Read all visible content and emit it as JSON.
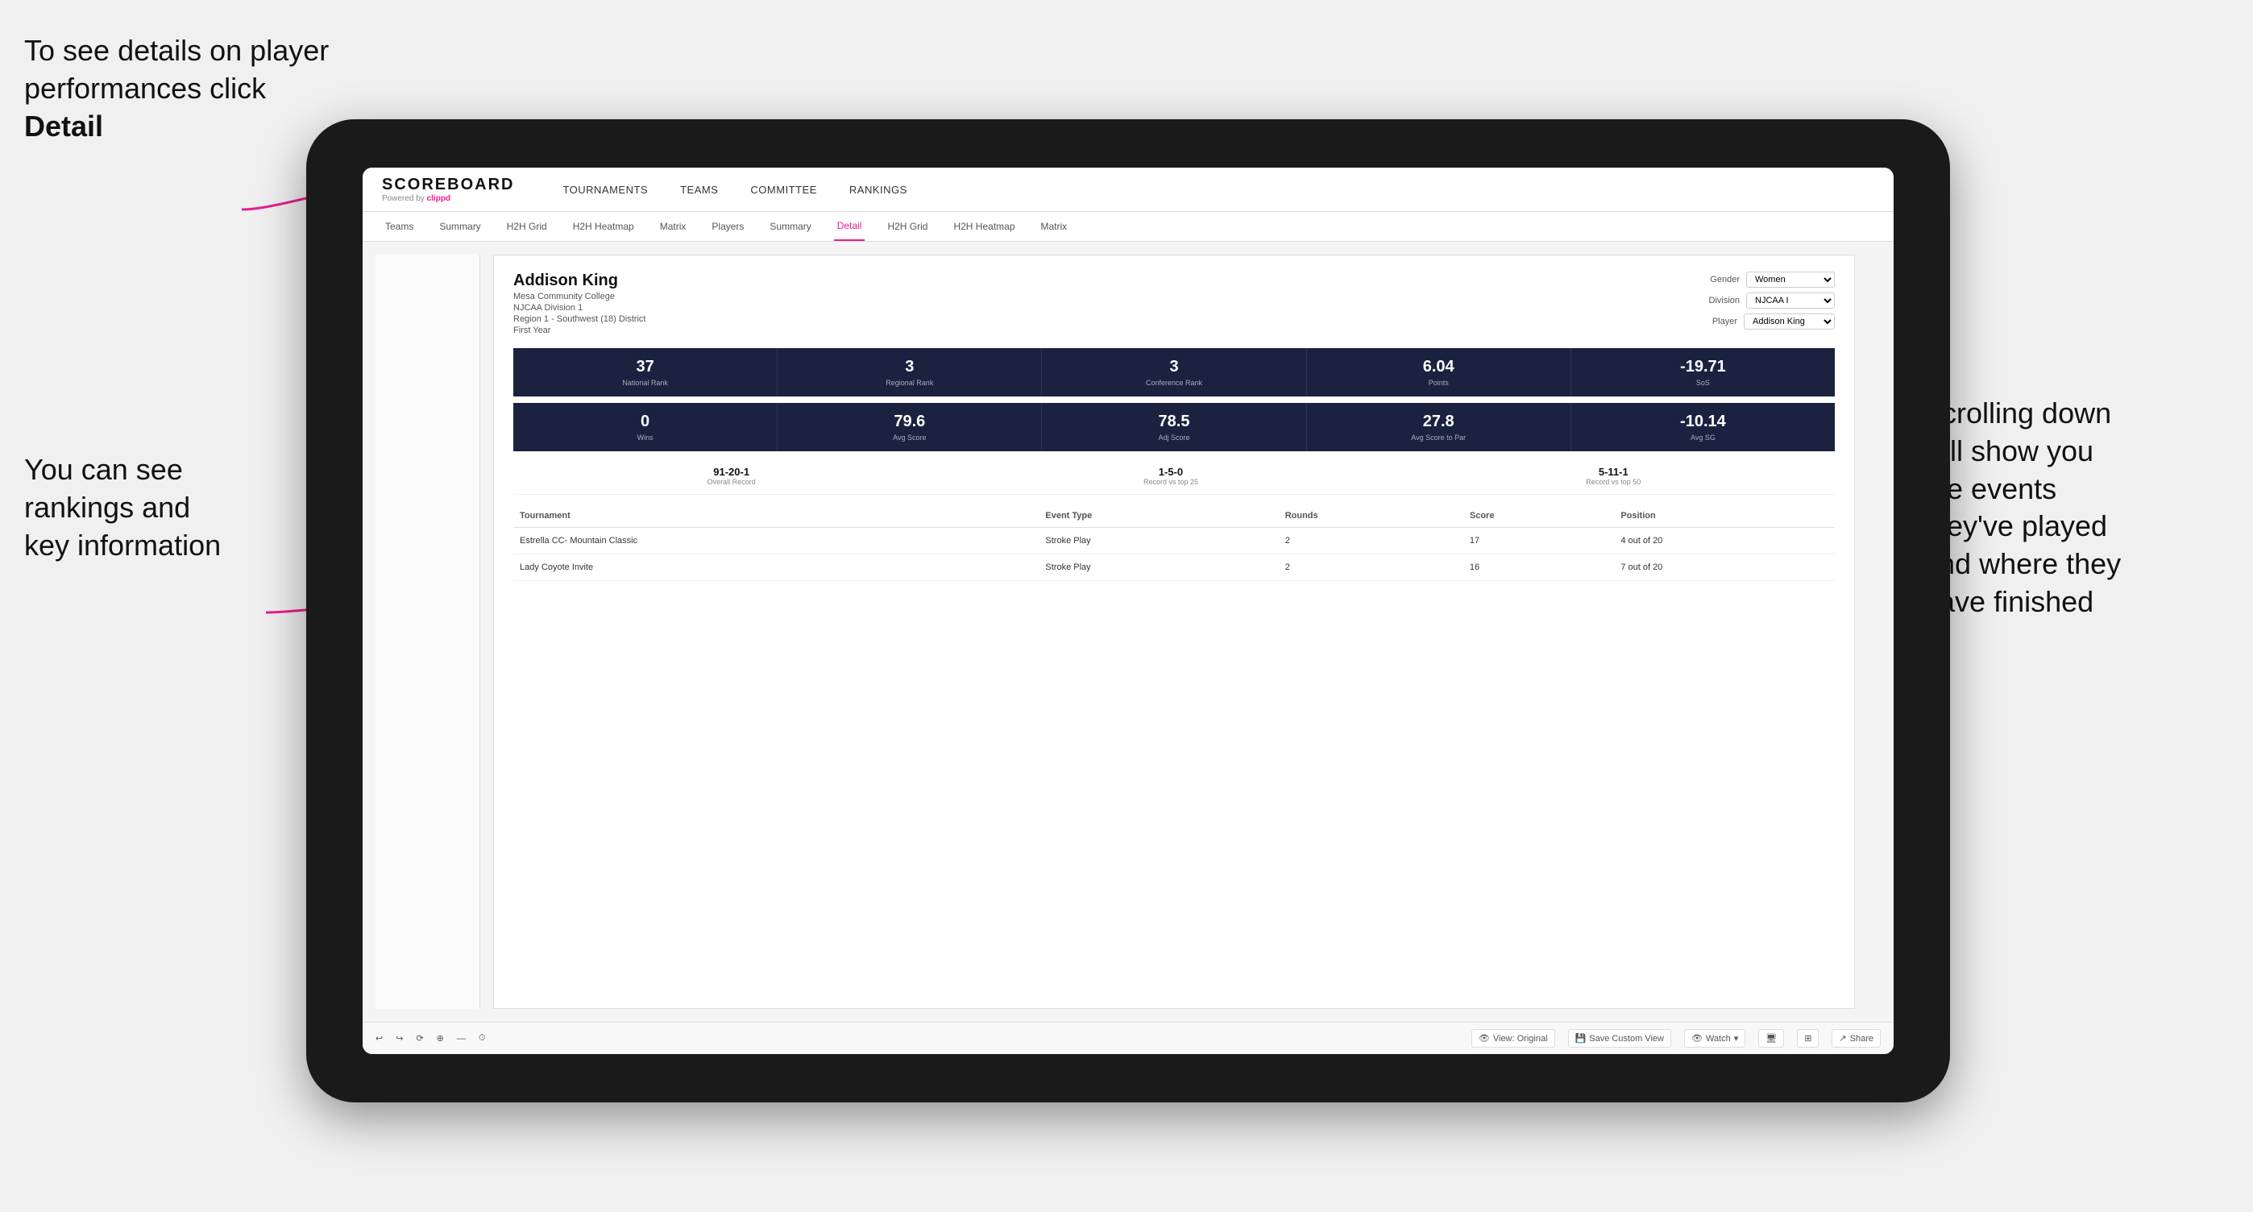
{
  "annotations": {
    "top_left": "To see details on player performances click ",
    "top_left_bold": "Detail",
    "bottom_left_line1": "You can see",
    "bottom_left_line2": "rankings and",
    "bottom_left_line3": "key information",
    "right_line1": "Scrolling down",
    "right_line2": "will show you",
    "right_line3": "the events",
    "right_line4": "they've played",
    "right_line5": "and where they",
    "right_line6": "have finished"
  },
  "nav": {
    "logo": "SCOREBOARD",
    "powered_by": "Powered by ",
    "clippd": "clippd",
    "items": [
      "TOURNAMENTS",
      "TEAMS",
      "COMMITTEE",
      "RANKINGS"
    ]
  },
  "subnav": {
    "items": [
      "Teams",
      "Summary",
      "H2H Grid",
      "H2H Heatmap",
      "Matrix",
      "Players",
      "Summary",
      "Detail",
      "H2H Grid",
      "H2H Heatmap",
      "Matrix"
    ],
    "active": "Detail"
  },
  "player": {
    "name": "Addison King",
    "school": "Mesa Community College",
    "division": "NJCAA Division 1",
    "region": "Region 1 - Southwest (18) District",
    "year": "First Year",
    "gender_label": "Gender",
    "gender_value": "Women",
    "division_label": "Division",
    "division_value": "NJCAA I",
    "player_label": "Player",
    "player_value": "Addison King"
  },
  "stats_row1": [
    {
      "value": "37",
      "label": "National Rank"
    },
    {
      "value": "3",
      "label": "Regional Rank"
    },
    {
      "value": "3",
      "label": "Conference Rank"
    },
    {
      "value": "6.04",
      "label": "Points"
    },
    {
      "value": "-19.71",
      "label": "SoS"
    }
  ],
  "stats_row2": [
    {
      "value": "0",
      "label": "Wins"
    },
    {
      "value": "79.6",
      "label": "Avg Score"
    },
    {
      "value": "78.5",
      "label": "Adj Score"
    },
    {
      "value": "27.8",
      "label": "Avg Score to Par"
    },
    {
      "value": "-10.14",
      "label": "Avg SG"
    }
  ],
  "records": [
    {
      "value": "91-20-1",
      "label": "Overall Record"
    },
    {
      "value": "1-5-0",
      "label": "Record vs top 25"
    },
    {
      "value": "5-11-1",
      "label": "Record vs top 50"
    }
  ],
  "table": {
    "headers": [
      "Tournament",
      "Event Type",
      "Rounds",
      "Score",
      "Position"
    ],
    "rows": [
      {
        "tournament": "Estrella CC- Mountain Classic",
        "event_type": "Stroke Play",
        "rounds": "2",
        "score": "17",
        "position": "4 out of 20"
      },
      {
        "tournament": "Lady Coyote Invite",
        "event_type": "Stroke Play",
        "rounds": "2",
        "score": "16",
        "position": "7 out of 20"
      }
    ]
  },
  "toolbar": {
    "view_original": "View: Original",
    "save_custom": "Save Custom View",
    "watch": "Watch",
    "share": "Share"
  }
}
